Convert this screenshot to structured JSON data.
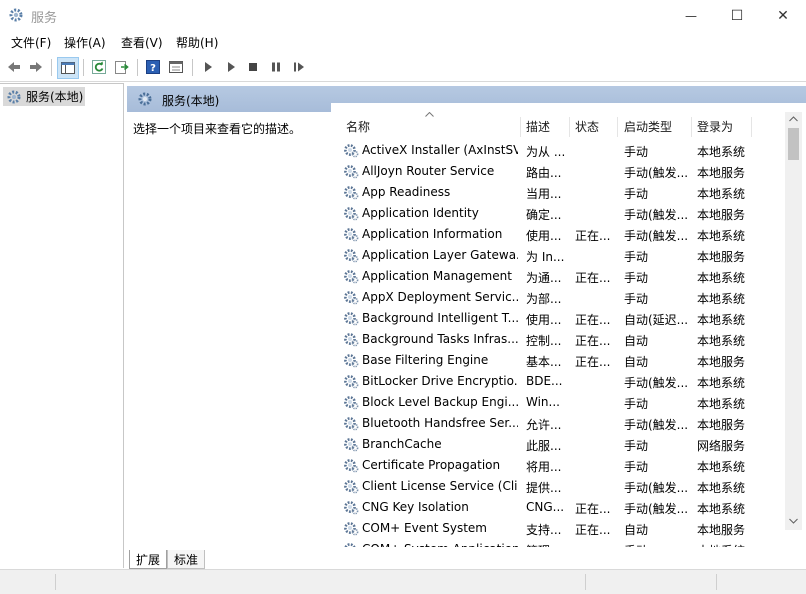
{
  "window": {
    "title": "服务",
    "minimize": "—",
    "maximize": "☐",
    "close": "✕"
  },
  "menu": [
    "文件(F)",
    "操作(A)",
    "查看(V)",
    "帮助(H)"
  ],
  "toolbar": {
    "icons": [
      "back-arrow-icon",
      "forward-arrow-icon",
      "console-tree-icon",
      "refresh-icon",
      "export-list-icon",
      "help-icon",
      "properties-icon",
      "start-service-icon",
      "start-service-alt-icon",
      "stop-service-icon",
      "pause-service-icon",
      "resume-service-icon"
    ]
  },
  "tree": {
    "node_label": "服务(本地)"
  },
  "content": {
    "header_title": "服务(本地)",
    "description_prompt": "选择一个项目来查看它的描述。"
  },
  "columns": [
    "名称",
    "描述",
    "状态",
    "启动类型",
    "登录为"
  ],
  "services": [
    {
      "name": "ActiveX Installer (AxInstSV)",
      "desc": "为从 ...",
      "status": "",
      "startup": "手动",
      "logon": "本地系统"
    },
    {
      "name": "AllJoyn Router Service",
      "desc": "路由...",
      "status": "",
      "startup": "手动(触发...",
      "logon": "本地服务"
    },
    {
      "name": "App Readiness",
      "desc": "当用...",
      "status": "",
      "startup": "手动",
      "logon": "本地系统"
    },
    {
      "name": "Application Identity",
      "desc": "确定...",
      "status": "",
      "startup": "手动(触发...",
      "logon": "本地服务"
    },
    {
      "name": "Application Information",
      "desc": "使用...",
      "status": "正在...",
      "startup": "手动(触发...",
      "logon": "本地系统"
    },
    {
      "name": "Application Layer Gatewa...",
      "desc": "为 In...",
      "status": "",
      "startup": "手动",
      "logon": "本地服务"
    },
    {
      "name": "Application Management",
      "desc": "为通...",
      "status": "正在...",
      "startup": "手动",
      "logon": "本地系统"
    },
    {
      "name": "AppX Deployment Servic...",
      "desc": "为部...",
      "status": "",
      "startup": "手动",
      "logon": "本地系统"
    },
    {
      "name": "Background Intelligent T...",
      "desc": "使用...",
      "status": "正在...",
      "startup": "自动(延迟...",
      "logon": "本地系统"
    },
    {
      "name": "Background Tasks Infras...",
      "desc": "控制...",
      "status": "正在...",
      "startup": "自动",
      "logon": "本地系统"
    },
    {
      "name": "Base Filtering Engine",
      "desc": "基本...",
      "status": "正在...",
      "startup": "自动",
      "logon": "本地服务"
    },
    {
      "name": "BitLocker Drive Encryptio...",
      "desc": "BDE...",
      "status": "",
      "startup": "手动(触发...",
      "logon": "本地系统"
    },
    {
      "name": "Block Level Backup Engi...",
      "desc": "Win...",
      "status": "",
      "startup": "手动",
      "logon": "本地系统"
    },
    {
      "name": "Bluetooth Handsfree Ser...",
      "desc": "允许...",
      "status": "",
      "startup": "手动(触发...",
      "logon": "本地服务"
    },
    {
      "name": "BranchCache",
      "desc": "此服...",
      "status": "",
      "startup": "手动",
      "logon": "网络服务"
    },
    {
      "name": "Certificate Propagation",
      "desc": "将用...",
      "status": "",
      "startup": "手动",
      "logon": "本地系统"
    },
    {
      "name": "Client License Service (Cli...",
      "desc": "提供...",
      "status": "",
      "startup": "手动(触发...",
      "logon": "本地系统"
    },
    {
      "name": "CNG Key Isolation",
      "desc": "CNG...",
      "status": "正在...",
      "startup": "手动(触发...",
      "logon": "本地系统"
    },
    {
      "name": "COM+ Event System",
      "desc": "支持...",
      "status": "正在...",
      "startup": "自动",
      "logon": "本地服务"
    },
    {
      "name": "COM+ System Application",
      "desc": "管理...",
      "status": "",
      "startup": "手动",
      "logon": "本地系统"
    }
  ],
  "tabs": [
    "扩展",
    "标准"
  ]
}
